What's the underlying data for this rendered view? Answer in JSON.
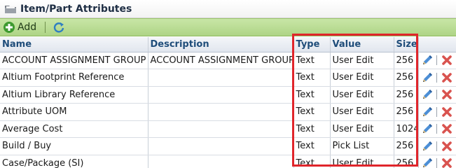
{
  "window": {
    "title": "Item/Part Attributes",
    "icon": "folder-icon"
  },
  "toolbar": {
    "add_label": "Add",
    "add_icon": "add-circle-icon",
    "refresh_icon": "refresh-icon"
  },
  "table": {
    "headers": {
      "name": "Name",
      "description": "Description",
      "type": "Type",
      "value": "Value",
      "size": "Size"
    },
    "rows": [
      {
        "name": "ACCOUNT ASSIGNMENT GROUP",
        "description": "ACCOUNT ASSIGNMENT GROUP",
        "type": "Text",
        "value": "User Edit",
        "size": "256"
      },
      {
        "name": "Altium Footprint Reference",
        "description": "",
        "type": "Text",
        "value": "User Edit",
        "size": "256"
      },
      {
        "name": "Altium Library Reference",
        "description": "",
        "type": "Text",
        "value": "User Edit",
        "size": "256"
      },
      {
        "name": "Attribute UOM",
        "description": "",
        "type": "Text",
        "value": "User Edit",
        "size": "256"
      },
      {
        "name": "Average Cost",
        "description": "",
        "type": "Text",
        "value": "User Edit",
        "size": "1024"
      },
      {
        "name": "Build / Buy",
        "description": "",
        "type": "Text",
        "value": "Pick List",
        "size": "256"
      },
      {
        "name": "Case/Package (SI)",
        "description": "",
        "type": "Text",
        "value": "User Edit",
        "size": "256"
      }
    ],
    "row_action_icons": [
      "pencil-icon",
      "delete-icon"
    ]
  },
  "colors": {
    "toolbar_green": "#b7dc91",
    "header_text": "#1f4d7a",
    "highlight_red": "#e0252b",
    "delete_red": "#d9534f"
  }
}
